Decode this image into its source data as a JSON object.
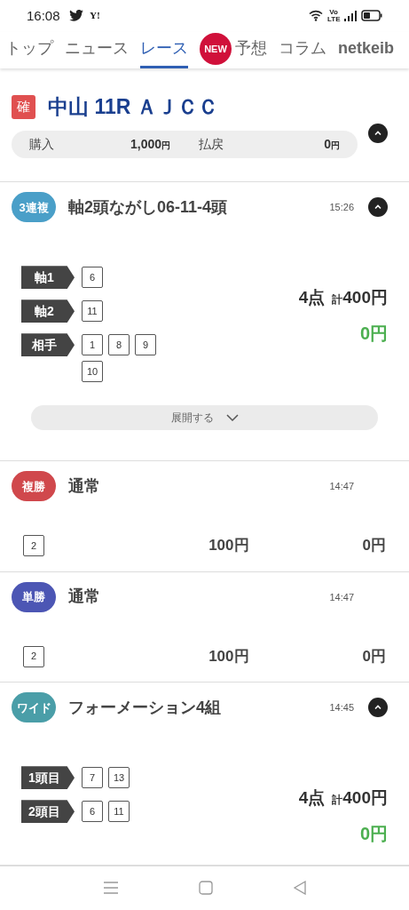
{
  "status_bar": {
    "time": "16:08",
    "app_mark": "Y!",
    "network_label": "Vo LTE"
  },
  "tabs": [
    {
      "label": "トップ",
      "selected": false
    },
    {
      "label": "ニュース",
      "selected": false
    },
    {
      "label": "レース",
      "selected": true
    },
    {
      "label": "予想",
      "selected": false,
      "badge": "NEW"
    },
    {
      "label": "コラム",
      "selected": false
    },
    {
      "label": "netkeib",
      "selected": false
    }
  ],
  "race": {
    "status_mark": "確",
    "title": "中山 11R ＡＪＣＣ",
    "expanded": true,
    "summary": [
      {
        "label": "購入",
        "value": "1,000",
        "unit": "円"
      },
      {
        "label": "払戻",
        "value": "0",
        "unit": "円"
      }
    ]
  },
  "bets": [
    {
      "kind": "legs",
      "type": "3連複",
      "color": "#4a9fc8",
      "title": "軸2頭ながし06-11-4頭",
      "time": "15:26",
      "expanded": true,
      "legs": [
        {
          "label": "軸1",
          "numbers": [
            "6"
          ]
        },
        {
          "label": "軸2",
          "numbers": [
            "11"
          ]
        },
        {
          "label": "相手",
          "numbers": [
            "1",
            "8",
            "9",
            "10"
          ]
        }
      ],
      "points": "4点",
      "total_prefix": "計",
      "total": "400円",
      "payout": "0円",
      "more_label": "展開する"
    },
    {
      "kind": "single",
      "type": "複勝",
      "color": "#d0484c",
      "title": "通常",
      "time": "14:47",
      "number": "2",
      "amount": "100円",
      "payout": "0円"
    },
    {
      "kind": "single",
      "type": "単勝",
      "color": "#4c56b4",
      "title": "通常",
      "time": "14:47",
      "number": "2",
      "amount": "100円",
      "payout": "0円"
    },
    {
      "kind": "legs",
      "type": "ワイド",
      "color": "#4a9ea8",
      "title": "フォーメーション4組",
      "time": "14:45",
      "expanded": true,
      "legs": [
        {
          "label": "1頭目",
          "numbers": [
            "7",
            "13"
          ]
        },
        {
          "label": "2頭目",
          "numbers": [
            "6",
            "11"
          ]
        }
      ],
      "points": "4点",
      "total_prefix": "計",
      "total": "400円",
      "payout": "0円"
    }
  ]
}
